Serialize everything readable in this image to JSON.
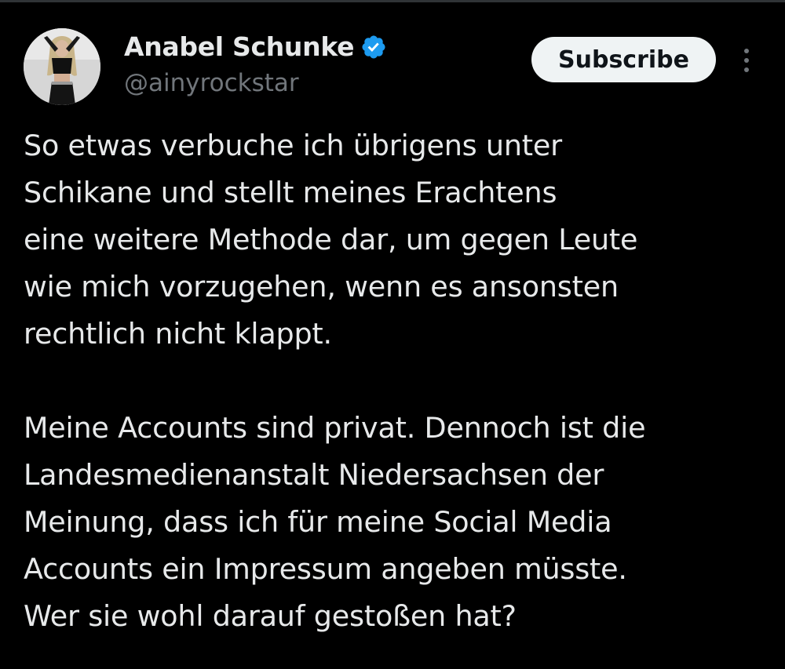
{
  "author": {
    "display_name": "Anabel Schunke",
    "handle": "@ainyrockstar",
    "verified": true,
    "verified_color": "#1d9bf0"
  },
  "actions": {
    "subscribe_label": "Subscribe",
    "more_icon": "more-vertical-icon"
  },
  "tweet": {
    "paragraph_1": [
      "So etwas verbuche ich übrigens unter",
      "Schikane und stellt meines Erachtens",
      "eine weitere Methode dar, um gegen Leute",
      "wie mich vorzugehen, wenn es ansonsten",
      "rechtlich nicht klappt."
    ],
    "paragraph_2": [
      "Meine Accounts sind privat. Dennoch ist die",
      "Landesmedienanstalt Niedersachsen der",
      "Meinung, dass ich für meine Social Media",
      "Accounts ein Impressum angeben müsste.",
      "Wer sie wohl darauf gestoßen hat?"
    ]
  },
  "colors": {
    "background": "#000000",
    "text_primary": "#e7e9ea",
    "text_secondary": "#71767b",
    "button_bg": "#eff3f4"
  }
}
